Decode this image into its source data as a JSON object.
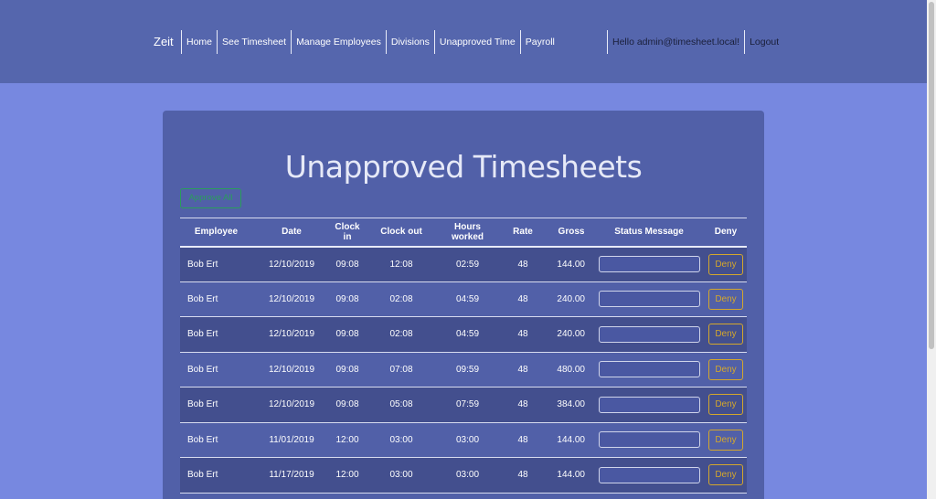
{
  "nav": {
    "brand": "Zeit",
    "links": [
      "Home",
      "See Timesheet",
      "Manage Employees",
      "Divisions",
      "Unapproved Time",
      "Payroll"
    ],
    "hello": "Hello admin@timesheet.local!",
    "logout": "Logout"
  },
  "main": {
    "title": "Unapproved Timesheets",
    "approve_all": "Approve All",
    "columns": [
      "Employee",
      "Date",
      "Clock in",
      "Clock out",
      "Hours worked",
      "Rate",
      "Gross",
      "Status Message",
      "Deny"
    ],
    "deny_label": "Deny",
    "rows": [
      {
        "employee": "Bob Ert",
        "date": "12/10/2019",
        "clock_in": "09:08",
        "clock_out": "12:08",
        "hours": "02:59",
        "rate": "48",
        "gross": "144.00"
      },
      {
        "employee": "Bob Ert",
        "date": "12/10/2019",
        "clock_in": "09:08",
        "clock_out": "02:08",
        "hours": "04:59",
        "rate": "48",
        "gross": "240.00"
      },
      {
        "employee": "Bob Ert",
        "date": "12/10/2019",
        "clock_in": "09:08",
        "clock_out": "02:08",
        "hours": "04:59",
        "rate": "48",
        "gross": "240.00"
      },
      {
        "employee": "Bob Ert",
        "date": "12/10/2019",
        "clock_in": "09:08",
        "clock_out": "07:08",
        "hours": "09:59",
        "rate": "48",
        "gross": "480.00"
      },
      {
        "employee": "Bob Ert",
        "date": "12/10/2019",
        "clock_in": "09:08",
        "clock_out": "05:08",
        "hours": "07:59",
        "rate": "48",
        "gross": "384.00"
      },
      {
        "employee": "Bob Ert",
        "date": "11/01/2019",
        "clock_in": "12:00",
        "clock_out": "03:00",
        "hours": "03:00",
        "rate": "48",
        "gross": "144.00"
      },
      {
        "employee": "Bob Ert",
        "date": "11/17/2019",
        "clock_in": "12:00",
        "clock_out": "03:00",
        "hours": "03:00",
        "rate": "48",
        "gross": "144.00"
      }
    ]
  },
  "colors": {
    "page_bg": "#7788e0",
    "navbar_bg": "#5566ad",
    "card_bg": "#5160a8",
    "row_dark": "#434f8e",
    "approve": "#2a9d5c",
    "deny": "#d4a72c"
  }
}
